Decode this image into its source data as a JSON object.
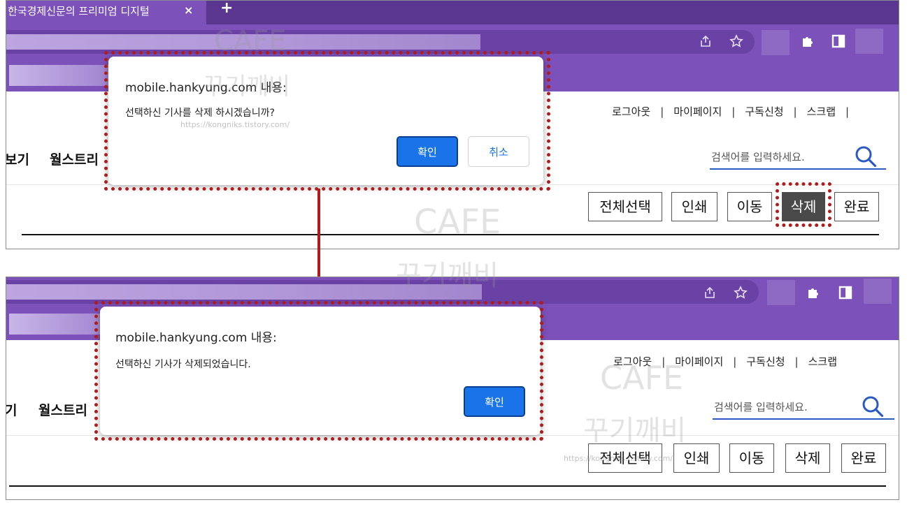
{
  "browser": {
    "tab_title": "한국경제신문의 프리미엄 디지털",
    "tab_close": "×",
    "new_tab": "+"
  },
  "site": {
    "util_links": [
      "로그아웃",
      "마이페이지",
      "구독신청",
      "스크랩"
    ],
    "nav_partial_1": "보기",
    "nav_partial_2": "월스트리",
    "nav_partial_1b": "기",
    "search_placeholder": "검색어를 입력하세요.",
    "actions": [
      "전체선택",
      "인쇄",
      "이동",
      "삭제",
      "완료"
    ]
  },
  "dialog_confirm": {
    "title": "mobile.hankyung.com 내용:",
    "message": "선택하신 기사를 삭제 하시겠습니까?",
    "ok_label": "확인",
    "cancel_label": "취소"
  },
  "dialog_alert": {
    "title": "mobile.hankyung.com 내용:",
    "message": "선택하신 기사가 삭제되었습니다.",
    "ok_label": "확인"
  },
  "watermark": {
    "line1": "CAFE",
    "line2": "꾸기깨비",
    "url": "https://kongniks.tistory.com/"
  },
  "colors": {
    "browser_purple": "#7c51b9",
    "highlight_red": "#b01c1c",
    "button_blue": "#1a73e8"
  }
}
